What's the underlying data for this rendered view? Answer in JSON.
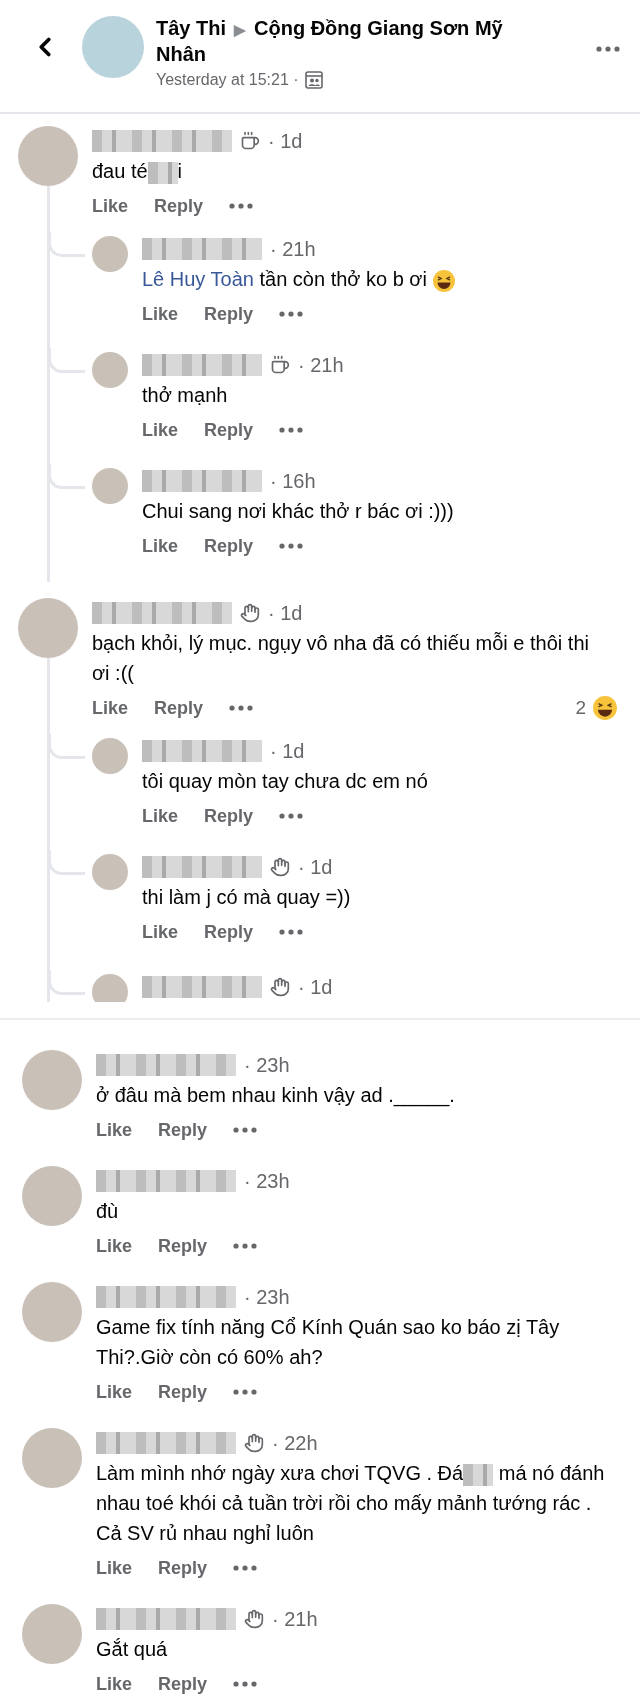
{
  "header": {
    "author": "Tây Thi",
    "separator": "▶",
    "group": "Cộng Đồng Giang Sơn Mỹ Nhân",
    "time": "Yesterday at 15:21 ·"
  },
  "sections": [
    {
      "comments": [
        {
          "badge": {
            "kind": "coffee"
          },
          "time": "· 1d",
          "body": [
            {
              "kind": "text",
              "text": "đau té"
            },
            {
              "kind": "blur"
            },
            {
              "kind": "text",
              "text": "i"
            }
          ],
          "actions": [
            "Like",
            "Reply"
          ],
          "replies": [
            {
              "time": "· 21h",
              "body": [
                {
                  "kind": "mention",
                  "text": "Lê Huy Toàn"
                },
                {
                  "kind": "text",
                  "text": " tần còn thở ko b ơi "
                },
                {
                  "kind": "emoji"
                }
              ],
              "actions": [
                "Like",
                "Reply"
              ]
            },
            {
              "badge": {
                "kind": "coffee"
              },
              "time": "· 21h",
              "body": [
                {
                  "kind": "text",
                  "text": "thở mạnh"
                }
              ],
              "actions": [
                "Like",
                "Reply"
              ]
            },
            {
              "time": "· 16h",
              "body": [
                {
                  "kind": "text",
                  "text": "Chui sang nơi khác thở r bác ơi :)))"
                }
              ],
              "actions": [
                "Like",
                "Reply"
              ]
            }
          ]
        },
        {
          "badge": {
            "kind": "wave"
          },
          "time": "· 1d",
          "body": [
            {
              "kind": "text",
              "text": "bạch khỏi, lý mục. ngụy vô nha đã có thiếu mỗi e thôi thi ơi :(("
            }
          ],
          "actions": [
            "Like",
            "Reply"
          ],
          "reactions": {
            "count": "2"
          },
          "replies": [
            {
              "time": "· 1d",
              "body": [
                {
                  "kind": "text",
                  "text": "tôi quay mòn tay chưa dc em nó"
                }
              ],
              "actions": [
                "Like",
                "Reply"
              ]
            },
            {
              "badge": {
                "kind": "wave"
              },
              "time": "· 1d",
              "body": [
                {
                  "kind": "text",
                  "text": "thi làm j có mà quay =))"
                }
              ],
              "actions": [
                "Like",
                "Reply"
              ]
            }
          ],
          "cut_reply": {
            "badge": {
              "kind": "wave"
            },
            "time": "· 1d"
          }
        }
      ]
    },
    {
      "comments": [
        {
          "time": "· 23h",
          "body": [
            {
              "kind": "text",
              "text": "ở đâu mà bem nhau kinh vậy ad ._____."
            }
          ],
          "actions": [
            "Like",
            "Reply"
          ]
        },
        {
          "time": "· 23h",
          "body": [
            {
              "kind": "text",
              "text": "đù"
            }
          ],
          "actions": [
            "Like",
            "Reply"
          ]
        },
        {
          "time": "· 23h",
          "body": [
            {
              "kind": "text",
              "text": "Game fix tính năng Cổ Kính Quán sao ko báo zị Tây Thi?.Giờ còn có 60% ah?"
            }
          ],
          "actions": [
            "Like",
            "Reply"
          ]
        },
        {
          "badge": {
            "kind": "wave"
          },
          "time": "· 22h",
          "body": [
            {
              "kind": "text",
              "text": "Làm mình nhớ ngày xưa chơi TQVG . Đá"
            },
            {
              "kind": "blur"
            },
            {
              "kind": "text",
              "text": " má nó đánh nhau toé khói cả tuần trời rồi cho mấy mảnh tướng rác . Cả SV rủ nhau nghỉ luôn"
            }
          ],
          "actions": [
            "Like",
            "Reply"
          ]
        },
        {
          "badge": {
            "kind": "wave"
          },
          "time": "· 21h",
          "body": [
            {
              "kind": "text",
              "text": "Gắt quá"
            }
          ],
          "actions": [
            "Like",
            "Reply"
          ]
        }
      ]
    }
  ]
}
